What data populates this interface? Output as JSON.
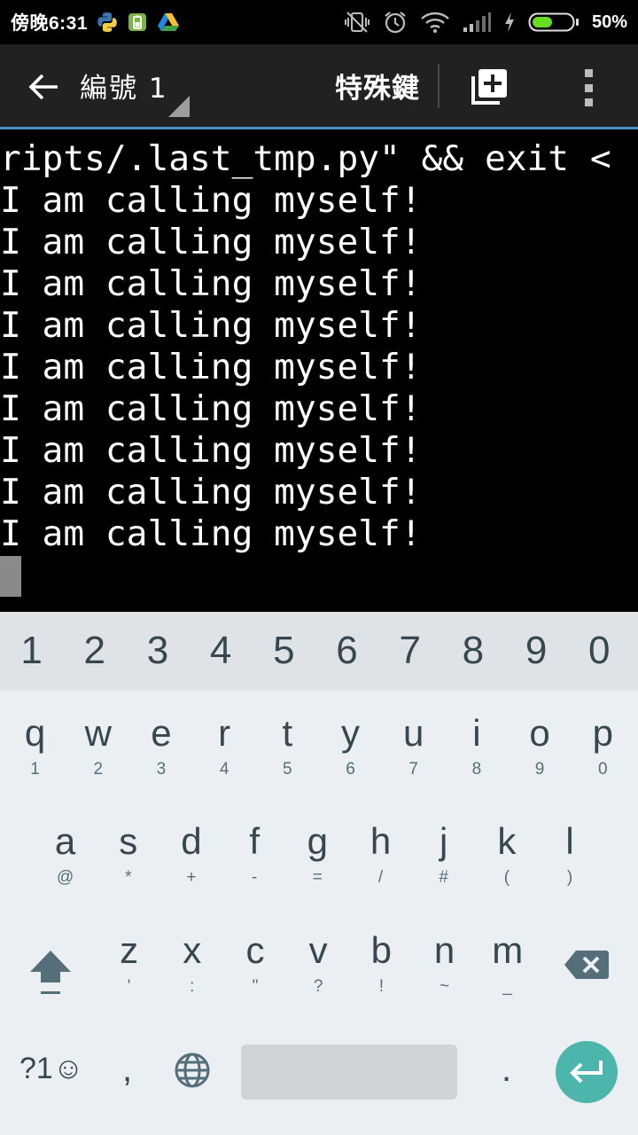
{
  "status_bar": {
    "time": "傍晚6:31",
    "battery_percent": "50%",
    "battery_level": 0.5,
    "notification_icons": [
      "python-icon",
      "android-battery-icon",
      "google-drive-icon"
    ],
    "system_icons": [
      "vibrate-off-icon",
      "alarm-icon",
      "wifi-icon",
      "signal-icon",
      "charging-icon",
      "battery-icon"
    ]
  },
  "toolbar": {
    "back_icon": "arrow-left-icon",
    "session_title": "編號 1",
    "special_keys_label": "特殊鍵",
    "new_session_icon": "add-box-icon",
    "overflow_icon": "more-vert-icon"
  },
  "terminal": {
    "lines": [
      "ripts/.last_tmp.py\" && exit <",
      "I am calling myself!",
      "I am calling myself!",
      "I am calling myself!",
      "I am calling myself!",
      "I am calling myself!",
      "I am calling myself!",
      "I am calling myself!",
      "I am calling myself!",
      "I am calling myself!"
    ]
  },
  "keyboard": {
    "number_row": [
      "1",
      "2",
      "3",
      "4",
      "5",
      "6",
      "7",
      "8",
      "9",
      "0"
    ],
    "row1": [
      {
        "main": "q",
        "sub": "1"
      },
      {
        "main": "w",
        "sub": "2"
      },
      {
        "main": "e",
        "sub": "3"
      },
      {
        "main": "r",
        "sub": "4"
      },
      {
        "main": "t",
        "sub": "5"
      },
      {
        "main": "y",
        "sub": "6"
      },
      {
        "main": "u",
        "sub": "7"
      },
      {
        "main": "i",
        "sub": "8"
      },
      {
        "main": "o",
        "sub": "9"
      },
      {
        "main": "p",
        "sub": "0"
      }
    ],
    "row2": [
      {
        "main": "a",
        "sub": "@"
      },
      {
        "main": "s",
        "sub": "*"
      },
      {
        "main": "d",
        "sub": "+"
      },
      {
        "main": "f",
        "sub": "-"
      },
      {
        "main": "g",
        "sub": "="
      },
      {
        "main": "h",
        "sub": "/"
      },
      {
        "main": "j",
        "sub": "#"
      },
      {
        "main": "k",
        "sub": "("
      },
      {
        "main": "l",
        "sub": ")"
      }
    ],
    "row3": [
      {
        "main": "z",
        "sub": "'"
      },
      {
        "main": "x",
        "sub": ":"
      },
      {
        "main": "c",
        "sub": "\""
      },
      {
        "main": "v",
        "sub": "?"
      },
      {
        "main": "b",
        "sub": "!"
      },
      {
        "main": "n",
        "sub": "~"
      },
      {
        "main": "m",
        "sub": "_"
      }
    ],
    "symbols_label": "?1☺",
    "comma": ",",
    "period": ".",
    "shift_icon": "shift-icon",
    "backspace_icon": "backspace-icon",
    "globe_icon": "globe-icon",
    "enter_icon": "enter-icon",
    "colors": {
      "enter_bg": "#4db6ac",
      "key_text": "#37474f"
    }
  }
}
